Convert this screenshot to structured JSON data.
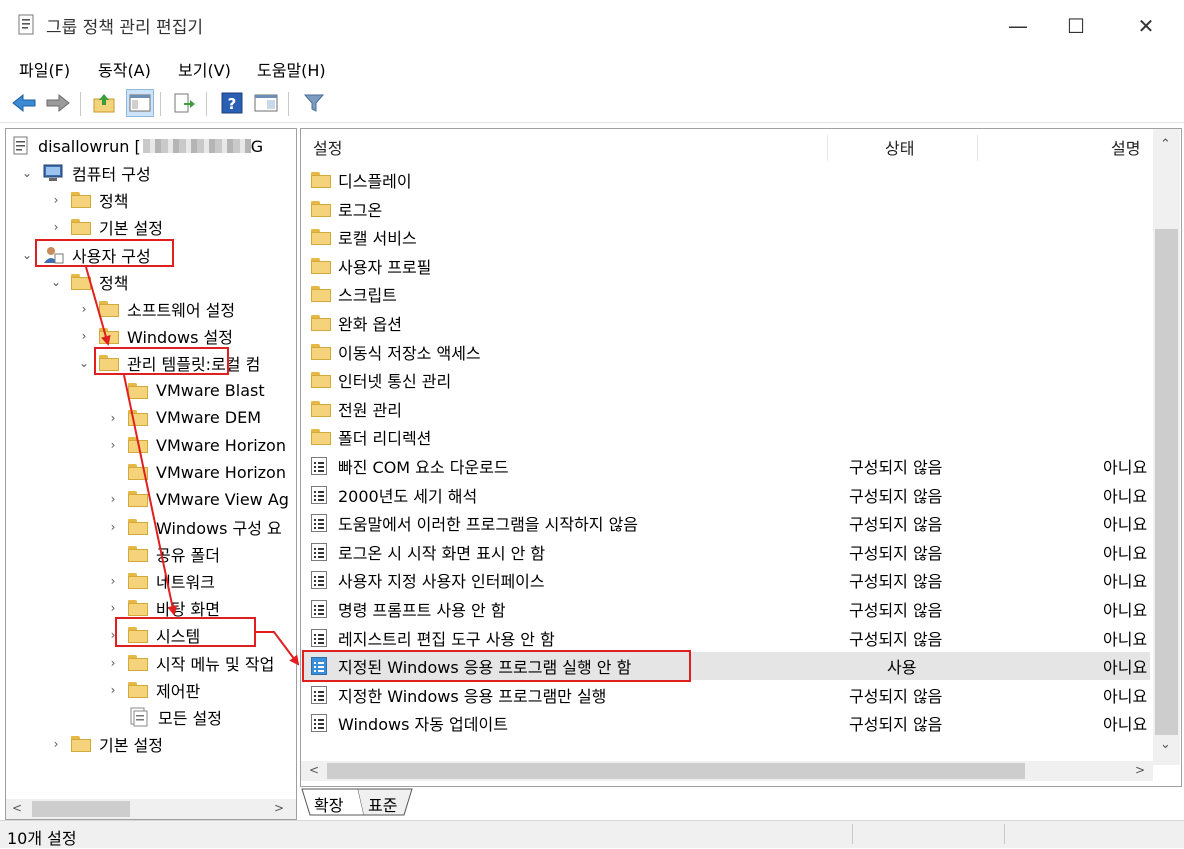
{
  "window": {
    "title": "그룹 정책 관리 편집기",
    "minimize": "—",
    "maximize": "☐",
    "close": "✕"
  },
  "menu": [
    "파일(F)",
    "동작(A)",
    "보기(V)",
    "도움말(H)"
  ],
  "toolbar": [
    "back-icon",
    "forward-icon",
    "up-folder-icon",
    "show-hide-tree-icon",
    "export-list-icon",
    "help-icon",
    "properties-icon",
    "filter-icon"
  ],
  "tree": {
    "root": "disallowrun [",
    "root_suffix": "G",
    "nodes": [
      {
        "label": "컴퓨터 구성",
        "exp": "⌄",
        "level": 0,
        "icon": "computer"
      },
      {
        "label": "정책",
        "exp": "›",
        "level": 1,
        "icon": "folder"
      },
      {
        "label": "기본 설정",
        "exp": "›",
        "level": 1,
        "icon": "folder"
      },
      {
        "label": "사용자 구성",
        "exp": "⌄",
        "level": 0,
        "icon": "user"
      },
      {
        "label": "정책",
        "exp": "⌄",
        "level": 1,
        "icon": "folder"
      },
      {
        "label": "소프트웨어 설정",
        "exp": "›",
        "level": 2,
        "icon": "folder"
      },
      {
        "label": "Windows 설정",
        "exp": "›",
        "level": 2,
        "icon": "folder"
      },
      {
        "label": "관리 템플릿:",
        "extra": "로컬 컴",
        "exp": "⌄",
        "level": 2,
        "icon": "folder"
      },
      {
        "label": "VMware Blast",
        "exp": "",
        "level": 3,
        "icon": "folder"
      },
      {
        "label": "VMware DEM",
        "exp": "›",
        "level": 3,
        "icon": "folder"
      },
      {
        "label": "VMware Horizon",
        "exp": "›",
        "level": 3,
        "icon": "folder"
      },
      {
        "label": "VMware Horizon",
        "exp": "",
        "level": 3,
        "icon": "folder"
      },
      {
        "label": "VMware View Ag",
        "exp": "›",
        "level": 3,
        "icon": "folder"
      },
      {
        "label": "Windows 구성 요",
        "exp": "›",
        "level": 3,
        "icon": "folder"
      },
      {
        "label": "공유 폴더",
        "exp": "",
        "level": 3,
        "icon": "folder"
      },
      {
        "label": "네트워크",
        "exp": "›",
        "level": 3,
        "icon": "folder"
      },
      {
        "label": "바탕 화면",
        "exp": "›",
        "level": 3,
        "icon": "folder"
      },
      {
        "label": "시스템",
        "exp": "›",
        "level": 3,
        "icon": "folder"
      },
      {
        "label": "시작 메뉴 및 작업",
        "exp": "›",
        "level": 3,
        "icon": "folder"
      },
      {
        "label": "제어판",
        "exp": "›",
        "level": 3,
        "icon": "folder"
      },
      {
        "label": "모든 설정",
        "exp": "",
        "level": 3,
        "icon": "allsettings"
      },
      {
        "label": "기본 설정",
        "exp": "›",
        "level": 1,
        "icon": "folder"
      }
    ]
  },
  "list": {
    "columns": [
      "설정",
      "상태",
      "설명"
    ],
    "rows": [
      {
        "name": "디스플레이",
        "state": "",
        "desc": "",
        "icon": "folder"
      },
      {
        "name": "로그온",
        "state": "",
        "desc": "",
        "icon": "folder"
      },
      {
        "name": "로캘 서비스",
        "state": "",
        "desc": "",
        "icon": "folder"
      },
      {
        "name": "사용자 프로필",
        "state": "",
        "desc": "",
        "icon": "folder"
      },
      {
        "name": "스크립트",
        "state": "",
        "desc": "",
        "icon": "folder"
      },
      {
        "name": "완화 옵션",
        "state": "",
        "desc": "",
        "icon": "folder"
      },
      {
        "name": "이동식 저장소 액세스",
        "state": "",
        "desc": "",
        "icon": "folder"
      },
      {
        "name": "인터넷 통신 관리",
        "state": "",
        "desc": "",
        "icon": "folder"
      },
      {
        "name": "전원 관리",
        "state": "",
        "desc": "",
        "icon": "folder"
      },
      {
        "name": "폴더 리디렉션",
        "state": "",
        "desc": "",
        "icon": "folder"
      },
      {
        "name": "빠진 COM 요소 다운로드",
        "state": "구성되지 않음",
        "desc": "아니요",
        "icon": "doc"
      },
      {
        "name": "2000년도 세기 해석",
        "state": "구성되지 않음",
        "desc": "아니요",
        "icon": "doc"
      },
      {
        "name": "도움말에서 이러한 프로그램을 시작하지 않음",
        "state": "구성되지 않음",
        "desc": "아니요",
        "icon": "doc"
      },
      {
        "name": "로그온 시 시작 화면 표시 안 함",
        "state": "구성되지 않음",
        "desc": "아니요",
        "icon": "doc"
      },
      {
        "name": "사용자 지정 사용자 인터페이스",
        "state": "구성되지 않음",
        "desc": "아니요",
        "icon": "doc"
      },
      {
        "name": "명령 프롬프트 사용 안 함",
        "state": "구성되지 않음",
        "desc": "아니요",
        "icon": "doc"
      },
      {
        "name": "레지스트리 편집 도구 사용 안 함",
        "state": "구성되지 않음",
        "desc": "아니요",
        "icon": "doc"
      },
      {
        "name": "지정된 Windows 응용 프로그램 실행 안 함",
        "state": "사용",
        "desc": "아니요",
        "icon": "docblue"
      },
      {
        "name": "지정한 Windows 응용 프로그램만 실행",
        "state": "구성되지 않음",
        "desc": "아니요",
        "icon": "doc"
      },
      {
        "name": "Windows 자동 업데이트",
        "state": "구성되지 않음",
        "desc": "아니요",
        "icon": "doc"
      }
    ]
  },
  "tabs": [
    "확장",
    "표준"
  ],
  "status": "10개 설정",
  "colors": {
    "annotation": "#e02020",
    "folder": "#f5d37a",
    "selected_row": "#e5e5e5"
  }
}
